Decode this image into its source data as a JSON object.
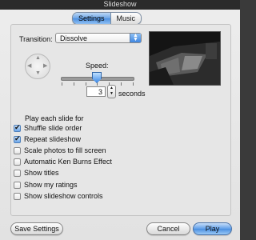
{
  "window": {
    "title": "Slideshow"
  },
  "tabs": [
    {
      "label": "Settings",
      "active": true
    },
    {
      "label": "Music",
      "active": false
    }
  ],
  "settings": {
    "transition_label": "Transition:",
    "transition_value": "Dissolve",
    "speed_label": "Speed:",
    "speed_fraction": 0.45,
    "play_each_label": "Play each slide for",
    "seconds_value": "3",
    "seconds_label": "seconds",
    "checkboxes": [
      {
        "label": "Shuffle slide order",
        "checked": true
      },
      {
        "label": "Repeat slideshow",
        "checked": true
      },
      {
        "label": "Scale photos to fill screen",
        "checked": false
      },
      {
        "label": "Automatic Ken Burns Effect",
        "checked": false
      },
      {
        "label": "Show titles",
        "checked": false
      },
      {
        "label": "Show my ratings",
        "checked": false
      },
      {
        "label": "Show slideshow controls",
        "checked": false
      }
    ]
  },
  "buttons": {
    "save_settings": "Save Settings",
    "cancel": "Cancel",
    "play": "Play"
  },
  "icons": {
    "direction_pad": "direction-arrows-icon",
    "popup_arrows": "up-down-arrows-icon",
    "checkmark": "checkmark-icon"
  },
  "colors": {
    "accent": "#4d8fdf",
    "window_bg": "#e6e6e6",
    "titlebar": "#2b2b2b"
  }
}
